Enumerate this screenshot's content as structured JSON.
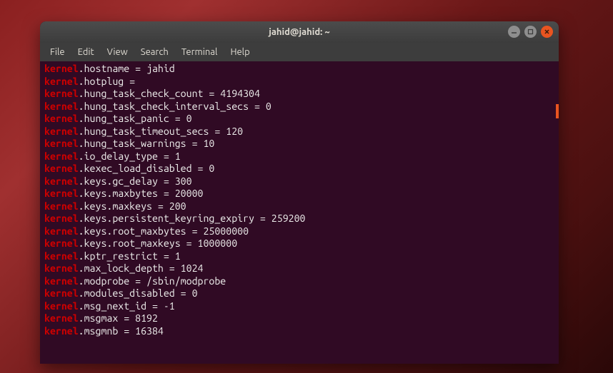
{
  "window": {
    "title": "jahid@jahid: ~"
  },
  "menu": {
    "items": [
      "File",
      "Edit",
      "View",
      "Search",
      "Terminal",
      "Help"
    ]
  },
  "terminal": {
    "prefix": "kernel",
    "lines": [
      {
        "key": ".hostname = ",
        "val": "jahid"
      },
      {
        "key": ".hotplug = ",
        "val": ""
      },
      {
        "key": ".hung_task_check_count = ",
        "val": "4194304"
      },
      {
        "key": ".hung_task_check_interval_secs = ",
        "val": "0"
      },
      {
        "key": ".hung_task_panic = ",
        "val": "0"
      },
      {
        "key": ".hung_task_timeout_secs = ",
        "val": "120"
      },
      {
        "key": ".hung_task_warnings = ",
        "val": "10"
      },
      {
        "key": ".io_delay_type = ",
        "val": "1"
      },
      {
        "key": ".kexec_load_disabled = ",
        "val": "0"
      },
      {
        "key": ".keys.gc_delay = ",
        "val": "300"
      },
      {
        "key": ".keys.maxbytes = ",
        "val": "20000"
      },
      {
        "key": ".keys.maxkeys = ",
        "val": "200"
      },
      {
        "key": ".keys.persistent_keyring_expiry = ",
        "val": "259200"
      },
      {
        "key": ".keys.root_maxbytes = ",
        "val": "25000000"
      },
      {
        "key": ".keys.root_maxkeys = ",
        "val": "1000000"
      },
      {
        "key": ".kptr_restrict = ",
        "val": "1"
      },
      {
        "key": ".max_lock_depth = ",
        "val": "1024"
      },
      {
        "key": ".modprobe = ",
        "val": "/sbin/modprobe"
      },
      {
        "key": ".modules_disabled = ",
        "val": "0"
      },
      {
        "key": ".msg_next_id = ",
        "val": "-1"
      },
      {
        "key": ".msgmax = ",
        "val": "8192"
      },
      {
        "key": ".msgmnb = ",
        "val": "16384"
      }
    ]
  }
}
